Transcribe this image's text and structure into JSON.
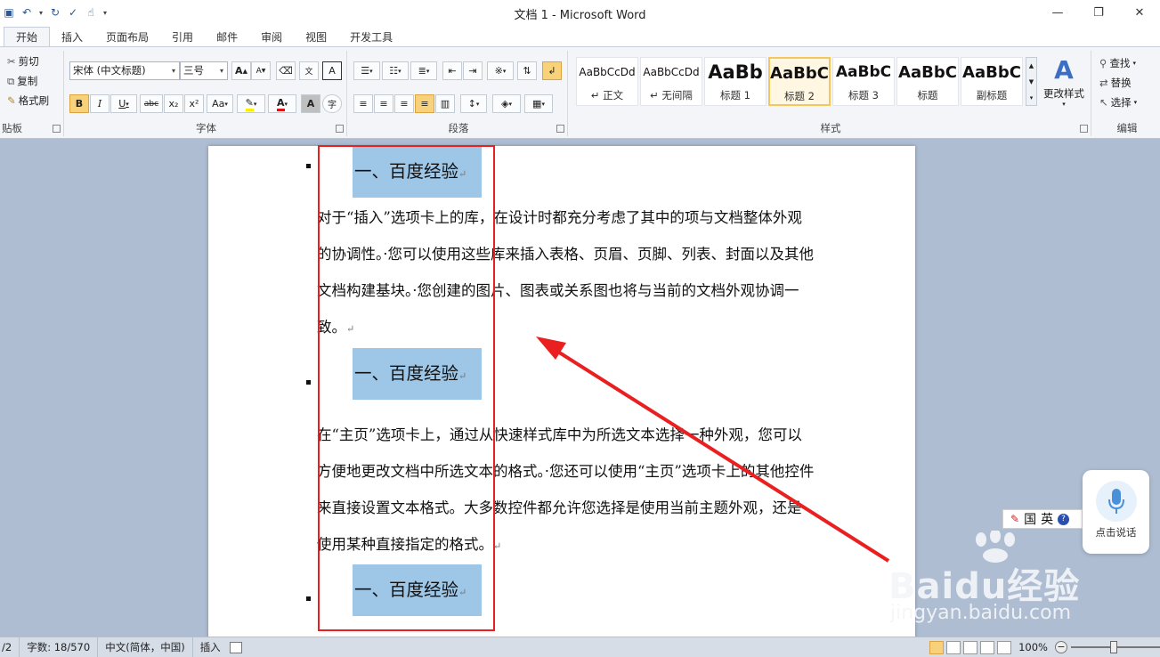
{
  "window": {
    "title": "文档 1 - Microsoft Word"
  },
  "tabs": [
    "开始",
    "插入",
    "页面布局",
    "引用",
    "邮件",
    "审阅",
    "视图",
    "开发工具"
  ],
  "clipboard": {
    "cut": "剪切",
    "copy": "复制",
    "format_painter": "格式刷",
    "label": "贴板"
  },
  "font": {
    "name": "宋体 (中文标题)",
    "size": "三号",
    "label": "字体",
    "grow": "A",
    "shrink": "A",
    "bold": "B",
    "italic": "I",
    "underline": "U",
    "strike": "abc",
    "sub": "x₂",
    "sup": "x²",
    "case": "Aa",
    "font_color_letter": "A",
    "char_shade": "A",
    "enclose": "字"
  },
  "paragraph": {
    "label": "段落"
  },
  "styles": {
    "label": "样式",
    "items": [
      {
        "sample": "AaBbCcDd",
        "name": "↵ 正文"
      },
      {
        "sample": "AaBbCcDd",
        "name": "↵ 无间隔"
      },
      {
        "sample": "AaBb",
        "name": "标题 1"
      },
      {
        "sample": "AaBbC",
        "name": "标题 2"
      },
      {
        "sample": "AaBbC",
        "name": "标题 3"
      },
      {
        "sample": "AaBbC",
        "name": "标题"
      },
      {
        "sample": "AaBbC",
        "name": "副标题"
      }
    ],
    "change": "更改样式"
  },
  "editing": {
    "find": "查找",
    "replace": "替换",
    "select": "选择",
    "label": "编辑"
  },
  "document": {
    "heading": "一、百度经验",
    "p1": "对于“插入”选项卡上的库，在设计时都充分考虑了其中的项与文档整体外观的协调性。·您可以使用这些库来插入表格、页眉、页脚、列表、封面以及其他文档构建基块。·您创建的图片、图表或关系图也将与当前的文档外观协调一致。",
    "p2": "在“主页”选项卡上，通过从快速样式库中为所选文本选择一种外观，您可以方便地更改文档中所选文本的格式。·您还可以使用“主页”选项卡上的其他控件来直接设置文本格式。大多数控件都允许您选择是使用当前主题外观，还是使用某种直接指定的格式。",
    "para_mark": "↵"
  },
  "ime": {
    "mode1": "国",
    "mode2": "英"
  },
  "voice": {
    "label": "点击说话"
  },
  "watermark": {
    "main": "Baidu经验",
    "sub": "jingyan.baidu.com"
  },
  "status": {
    "page": "/2",
    "words": "字数: 18/570",
    "lang": "中文(简体，中国)",
    "mode": "插入",
    "zoom": "100%"
  },
  "colors": {
    "accent": "#2b579a",
    "highlight": "#9ec6e6",
    "annotation": "#ea2020"
  }
}
